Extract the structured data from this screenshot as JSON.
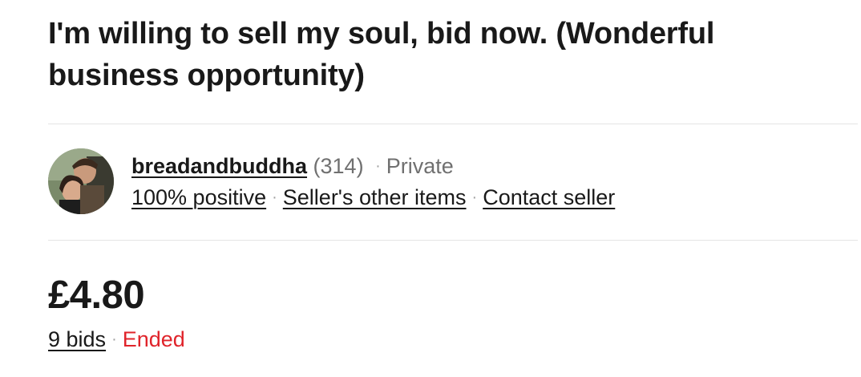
{
  "listing": {
    "title": "I'm willing to sell my soul, bid now. (Wonderful business opportunity)"
  },
  "seller": {
    "avatar_icon": "seller-photo-avatar",
    "name": "breadandbuddha",
    "feedback_count": "(314)",
    "separator": "·",
    "account_type": "Private",
    "positive": "100% positive",
    "other_items": "Seller's other items",
    "contact": "Contact seller"
  },
  "price": {
    "amount": "£4.80",
    "bids": "9 bids",
    "status": "Ended",
    "status_color": "#e0242b"
  }
}
